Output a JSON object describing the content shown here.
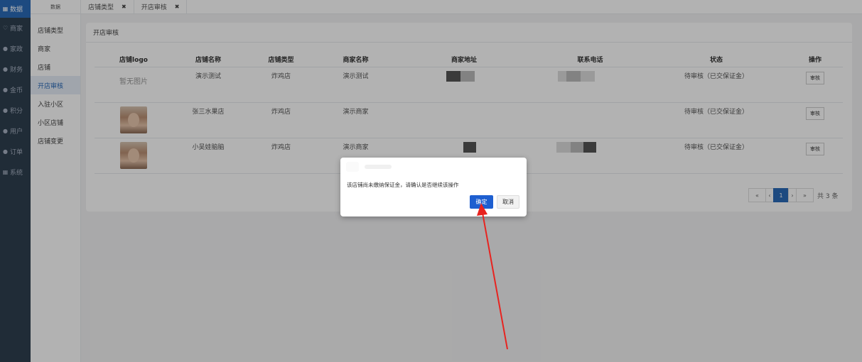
{
  "nav": {
    "items": [
      {
        "icon": "grid-icon",
        "glyph": "▦",
        "label": "数据"
      },
      {
        "icon": "heart-icon",
        "glyph": "♡",
        "label": "商家"
      },
      {
        "icon": "circle-icon",
        "glyph": "●",
        "label": "家政"
      },
      {
        "icon": "circle-icon",
        "glyph": "●",
        "label": "财务"
      },
      {
        "icon": "circle-icon",
        "glyph": "●",
        "label": "金币"
      },
      {
        "icon": "circle-icon",
        "glyph": "●",
        "label": "积分"
      },
      {
        "icon": "circle-icon",
        "glyph": "●",
        "label": "用户"
      },
      {
        "icon": "circle-icon",
        "glyph": "●",
        "label": "订单"
      },
      {
        "icon": "grid-icon",
        "glyph": "▦",
        "label": "系统"
      }
    ]
  },
  "subnav": {
    "header": "数据",
    "items": [
      "店铺类型",
      "商家",
      "店铺",
      "开店审核",
      "入驻小区",
      "小区店铺",
      "店铺变更"
    ]
  },
  "tabs": [
    {
      "label": "店铺类型",
      "close": "✖"
    },
    {
      "label": "开店审核",
      "close": "✖"
    }
  ],
  "panel": {
    "title": "开店审核"
  },
  "table": {
    "headers": [
      "店铺logo",
      "店铺名称",
      "店铺类型",
      "商家名称",
      "商家地址",
      "联系电话",
      "状态",
      "操作"
    ],
    "rows": [
      {
        "logo_text": "暂无图片",
        "name": "演示测试",
        "type": "炸鸡店",
        "merchant": "演示测试",
        "status": "待审核（已交保证金）",
        "action": "审核"
      },
      {
        "logo_text": "",
        "name": "张三水果店",
        "type": "炸鸡店",
        "merchant": "演示商家",
        "status": "待审核（已交保证金）",
        "action": "审核"
      },
      {
        "logo_text": "",
        "name": "小吴娃脑脑",
        "type": "炸鸡店",
        "merchant": "演示商家",
        "status": "待审核（已交保证金）",
        "action": "审核"
      }
    ]
  },
  "pagination": {
    "first": "«",
    "prev": "‹",
    "current": "1",
    "next": "›",
    "last": "»",
    "total": "共 3 条"
  },
  "dialog": {
    "message": "该店铺尚未缴纳保证金，请确认是否继续该操作",
    "ok_label": "确定",
    "cancel_label": "取消"
  },
  "colors": {
    "accent": "#2a6ab8",
    "ok_button": "#1e5fd0",
    "arrow": "#e8231f"
  }
}
